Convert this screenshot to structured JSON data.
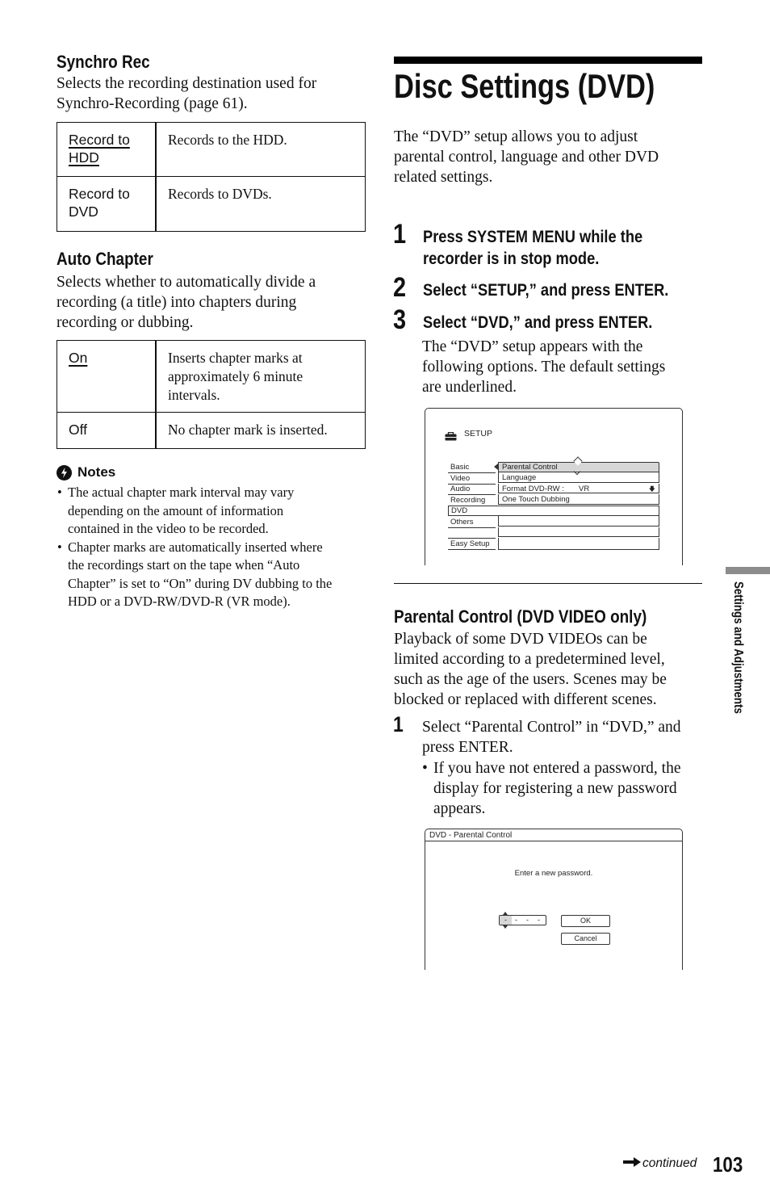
{
  "left": {
    "synchro": {
      "heading": "Synchro Rec",
      "desc_lines": [
        "Selects the recording destination used for",
        "Synchro-Recording (page 61)."
      ],
      "rows": [
        {
          "key_lines": [
            "Record to",
            "HDD"
          ],
          "value": "Records to the HDD.",
          "default": true
        },
        {
          "key_lines": [
            "Record to",
            "DVD"
          ],
          "value": "Records to DVDs.",
          "default": false
        }
      ]
    },
    "auto_chapter": {
      "heading": "Auto Chapter",
      "desc_lines": [
        "Selects whether to automatically divide a",
        "recording (a title) into chapters during",
        "recording or dubbing."
      ],
      "rows": [
        {
          "key": "On",
          "value_lines": [
            "Inserts chapter marks at",
            "approximately 6 minute",
            "intervals."
          ],
          "default": true
        },
        {
          "key": "Off",
          "value_lines": [
            "No chapter mark is inserted."
          ],
          "default": false
        }
      ]
    },
    "notes": {
      "icon": "notes-icon",
      "heading": "Notes",
      "items": [
        [
          "The actual chapter mark interval may vary",
          "depending on the amount of information",
          "contained in the video to be recorded."
        ],
        [
          "Chapter marks are automatically inserted where",
          "the recordings start on the tape when “Auto",
          "Chapter” is set to “On” during DV dubbing to the",
          "HDD or a DVD-RW/DVD-R (VR mode)."
        ]
      ]
    }
  },
  "right": {
    "title": "Disc Settings (DVD)",
    "intro_lines": [
      "The “DVD” setup allows you to adjust",
      "parental control, language and other DVD",
      "related settings."
    ],
    "steps": [
      {
        "num": "1",
        "lines": [
          "Press SYSTEM MENU while the",
          "recorder is in stop mode."
        ]
      },
      {
        "num": "2",
        "lines": [
          "Select “SETUP,” and press ENTER."
        ]
      },
      {
        "num": "3",
        "lines": [
          "Select “DVD,” and press ENTER."
        ],
        "note_lines": [
          "The “DVD” setup appears with the",
          "following options. The default settings",
          "are underlined."
        ]
      }
    ],
    "setup_screen": {
      "icon": "toolbox-icon",
      "title": "SETUP",
      "left_items": [
        "Basic",
        "Video",
        "Audio",
        "Recording",
        "DVD",
        "Others",
        "",
        "Easy Setup"
      ],
      "selected_left": "DVD",
      "right_items": [
        "Parental Control",
        "Language",
        "Format DVD-RW :",
        "One Touch Dubbing",
        "",
        "",
        ""
      ],
      "format_value": "VR",
      "highlighted_item": "Parental Control"
    },
    "parental": {
      "heading": "Parental Control (DVD VIDEO only)",
      "desc_lines": [
        "Playback of some DVD VIDEOs can be",
        "limited according to a predetermined level,",
        "such as the age of the users. Scenes may be",
        "blocked or replaced with different scenes."
      ],
      "step": {
        "num": "1",
        "lines": [
          "Select “Parental Control” in “DVD,” and",
          "press ENTER."
        ],
        "bullet_lines": [
          "If you have not entered a password, the",
          "display for registering a new password",
          "appears."
        ]
      }
    },
    "password_screen": {
      "title": "DVD - Parental Control",
      "prompt": "Enter a new password.",
      "digits": [
        "-",
        "-",
        "-",
        "-"
      ],
      "ok_label": "OK",
      "cancel_label": "Cancel"
    }
  },
  "side_tab": {
    "label": "Settings and Adjustments",
    "color": "#8c8c8c"
  },
  "footer": {
    "continued": "continued",
    "page_number": "103"
  }
}
